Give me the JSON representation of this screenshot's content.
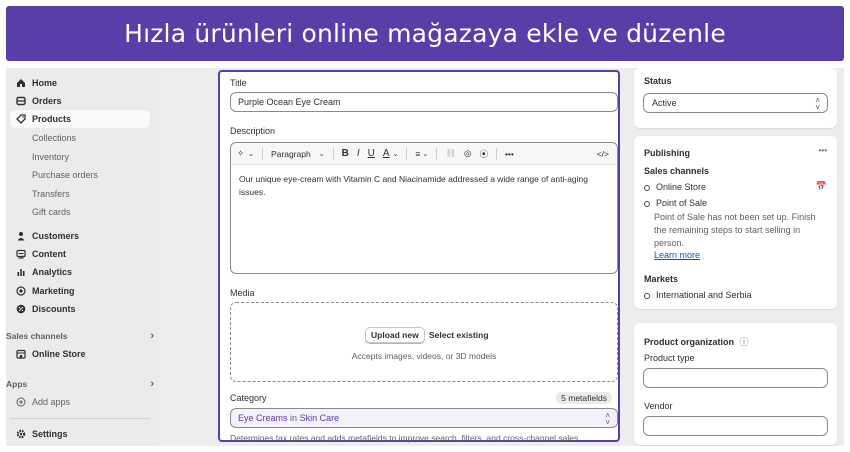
{
  "banner": {
    "title": "Hızla ürünleri online mağazaya ekle ve düzenle"
  },
  "sidebar": {
    "items": [
      {
        "label": "Home",
        "icon": "home-icon"
      },
      {
        "label": "Orders",
        "icon": "orders-icon"
      },
      {
        "label": "Products",
        "icon": "tag-icon",
        "active": true
      }
    ],
    "product_subitems": [
      "Collections",
      "Inventory",
      "Purchase orders",
      "Transfers",
      "Gift cards"
    ],
    "more_items": [
      {
        "label": "Customers",
        "icon": "person-icon"
      },
      {
        "label": "Content",
        "icon": "content-icon"
      },
      {
        "label": "Analytics",
        "icon": "bar-chart-icon"
      },
      {
        "label": "Marketing",
        "icon": "target-icon"
      },
      {
        "label": "Discounts",
        "icon": "discount-icon"
      }
    ],
    "sales_channels_label": "Sales channels",
    "online_store_label": "Online Store",
    "apps_label": "Apps",
    "add_apps_label": "Add apps",
    "settings_label": "Settings"
  },
  "product": {
    "title_label": "Title",
    "title_value": "Purple Ocean Eye Cream",
    "description_label": "Description",
    "toolbar": {
      "paragraph": "Paragraph",
      "bold": "B",
      "italic": "I",
      "underline": "U",
      "color": "A",
      "more": "•••",
      "code": "</>"
    },
    "description_text": "Our unique eye-cream with Vitamin C and Niacinamide addressed a wide range of anti-aging issues.",
    "media_label": "Media",
    "upload_new": "Upload new",
    "select_existing": "Select existing",
    "accepts_text": "Accepts images, videos, or 3D models",
    "category_label": "Category",
    "metafields_badge": "5 metafields",
    "category_name": "Eye Creams",
    "category_in": "in",
    "category_parent": "Skin Care",
    "category_help": "Determines tax rates and adds metafields to improve search, filters, and cross-channel sales"
  },
  "status": {
    "label": "Status",
    "value": "Active"
  },
  "publishing": {
    "title": "Publishing",
    "more": "•••",
    "sales_channels_label": "Sales channels",
    "online_store": "Online Store",
    "point_of_sale": "Point of Sale",
    "pos_note": "Point of Sale has not been set up. Finish the remaining steps to start selling in person.",
    "learn_more": "Learn more",
    "markets_label": "Markets",
    "market_value": "International and Serbia"
  },
  "organization": {
    "title": "Product organization",
    "info": "ⓘ",
    "product_type_label": "Product type",
    "vendor_label": "Vendor"
  },
  "colors": {
    "accent": "#5a3ea8",
    "link": "#005bd3",
    "sidebar_bg": "#ebebeb"
  }
}
